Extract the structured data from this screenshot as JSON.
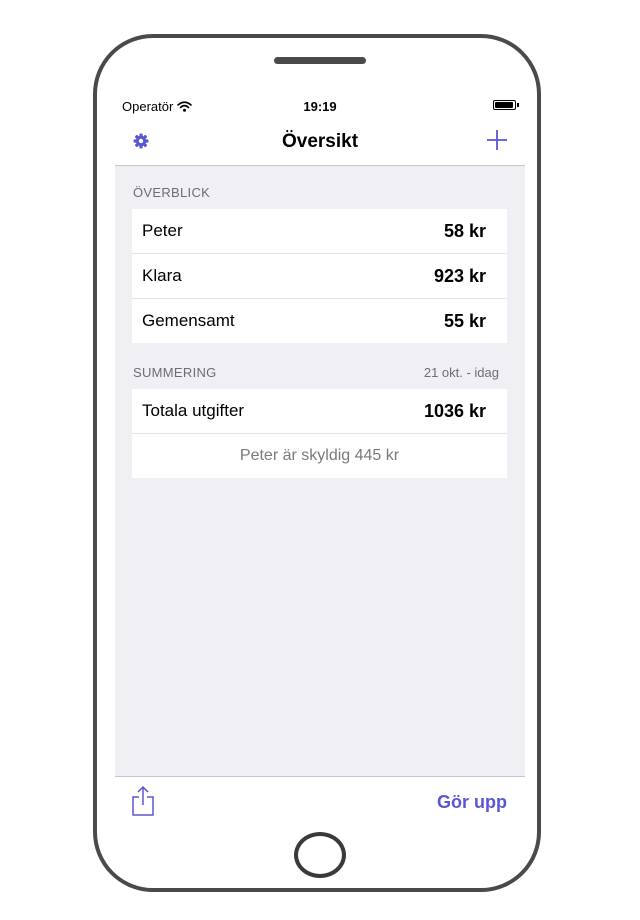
{
  "status_bar": {
    "carrier": "Operatör",
    "time": "19:19"
  },
  "nav": {
    "title": "Översikt"
  },
  "overview": {
    "header": "ÖVERBLICK",
    "rows": [
      {
        "label": "Peter",
        "value": "58 kr"
      },
      {
        "label": "Klara",
        "value": "923 kr"
      },
      {
        "label": "Gemensamt",
        "value": "55 kr"
      }
    ]
  },
  "summary": {
    "header": "SUMMERING",
    "period": "21 okt. - idag",
    "total_label": "Totala utgifter",
    "total_value": "1036 kr",
    "debt_text": "Peter är skyldig 445 kr"
  },
  "toolbar": {
    "settle_label": "Gör upp"
  },
  "colors": {
    "accent": "#5856d6",
    "background": "#efeff4",
    "separator": "#c8c7cc"
  }
}
